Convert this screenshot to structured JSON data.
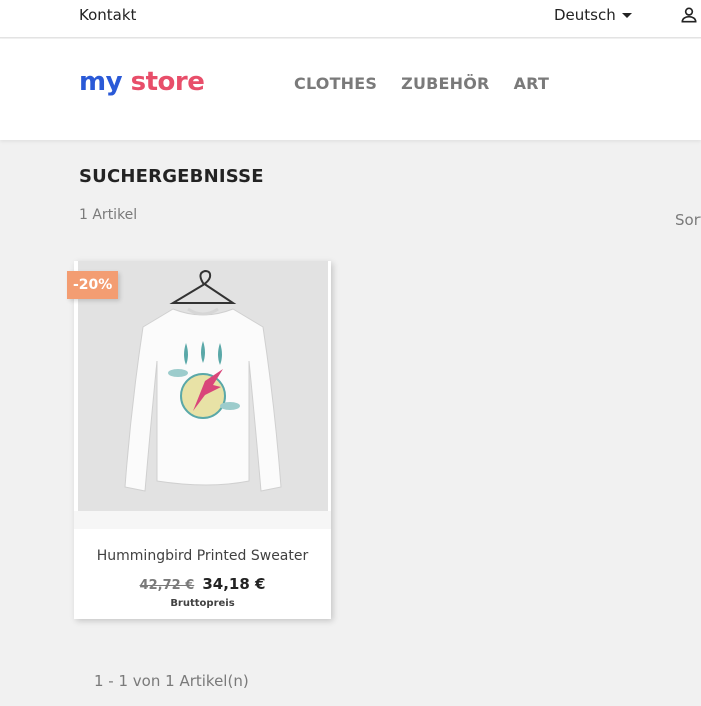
{
  "topbar": {
    "contact_label": "Kontakt",
    "language_label": "Deutsch",
    "user_icon": "user-icon"
  },
  "header": {
    "logo_text_1": "my",
    "logo_text_2": "store",
    "nav": [
      {
        "label": "CLOTHES"
      },
      {
        "label": "ZUBEHÖR"
      },
      {
        "label": "ART"
      }
    ]
  },
  "main": {
    "title": "SUCHERGEBNISSE",
    "count_text": "1 Artikel",
    "sort_label_partial": "Sort"
  },
  "product": {
    "discount_badge": "-20%",
    "name": "Hummingbird Printed Sweater",
    "old_price": "42,72 €",
    "price": "34,18 €",
    "tax_label": "Bruttopreis"
  },
  "pagination": {
    "text": "1 - 1 von 1 Artikel(n)"
  },
  "colors": {
    "badge": "#f39d72",
    "background": "#f1f1f1",
    "nav_text": "#7a7a7a"
  }
}
